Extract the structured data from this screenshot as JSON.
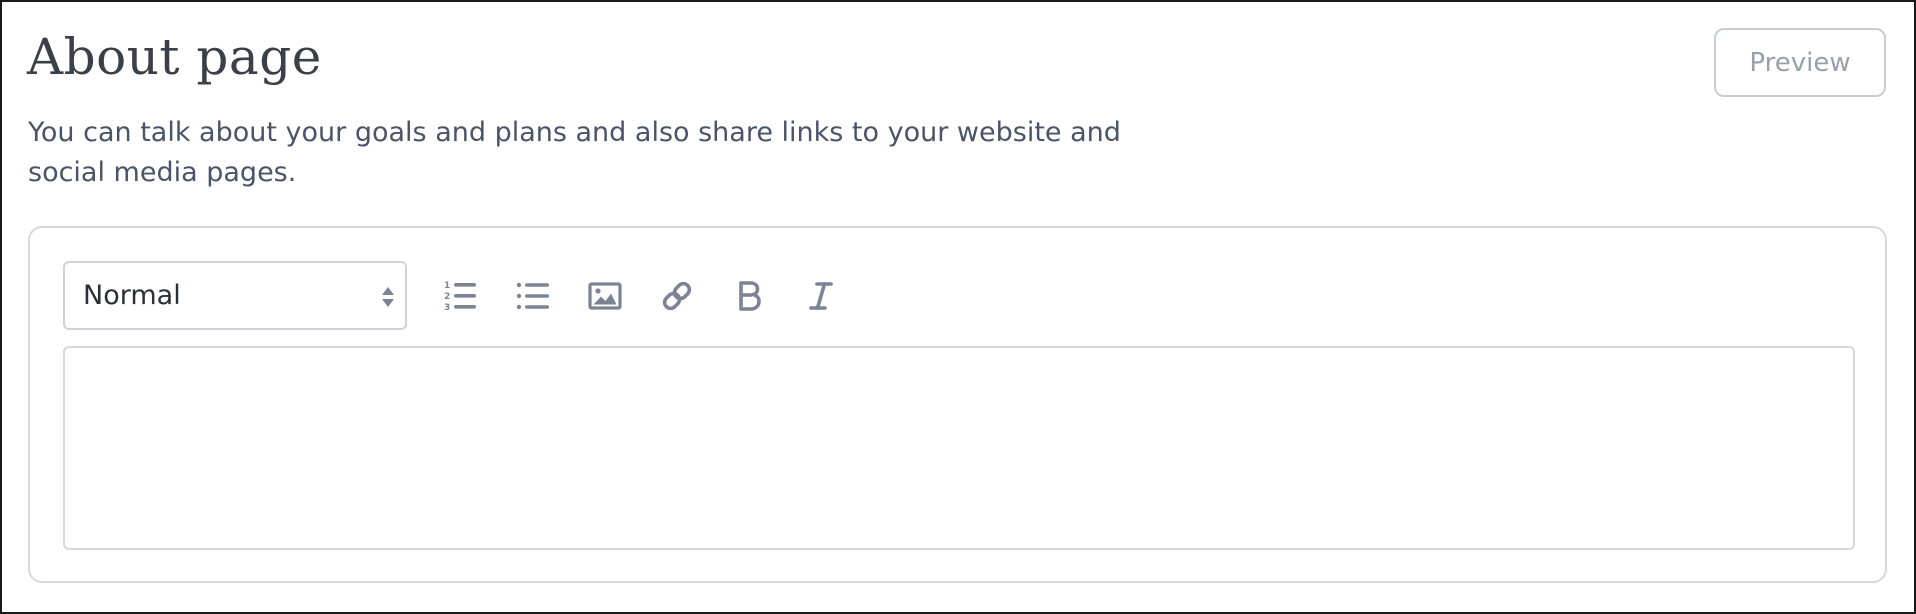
{
  "header": {
    "title": "About page",
    "preview_label": "Preview"
  },
  "description": "You can talk about your goals and plans and also share links to your website and social media pages.",
  "editor": {
    "format_select": {
      "selected": "Normal"
    },
    "toolbar": [
      {
        "name": "ordered-list-icon"
      },
      {
        "name": "bulleted-list-icon"
      },
      {
        "name": "image-icon"
      },
      {
        "name": "link-icon"
      },
      {
        "name": "bold-icon"
      },
      {
        "name": "italic-icon"
      }
    ],
    "content": ""
  },
  "colors": {
    "icon": "#7c8395",
    "text": "#4a5468",
    "title": "#3b3f47",
    "border": "#d6d8dd"
  }
}
